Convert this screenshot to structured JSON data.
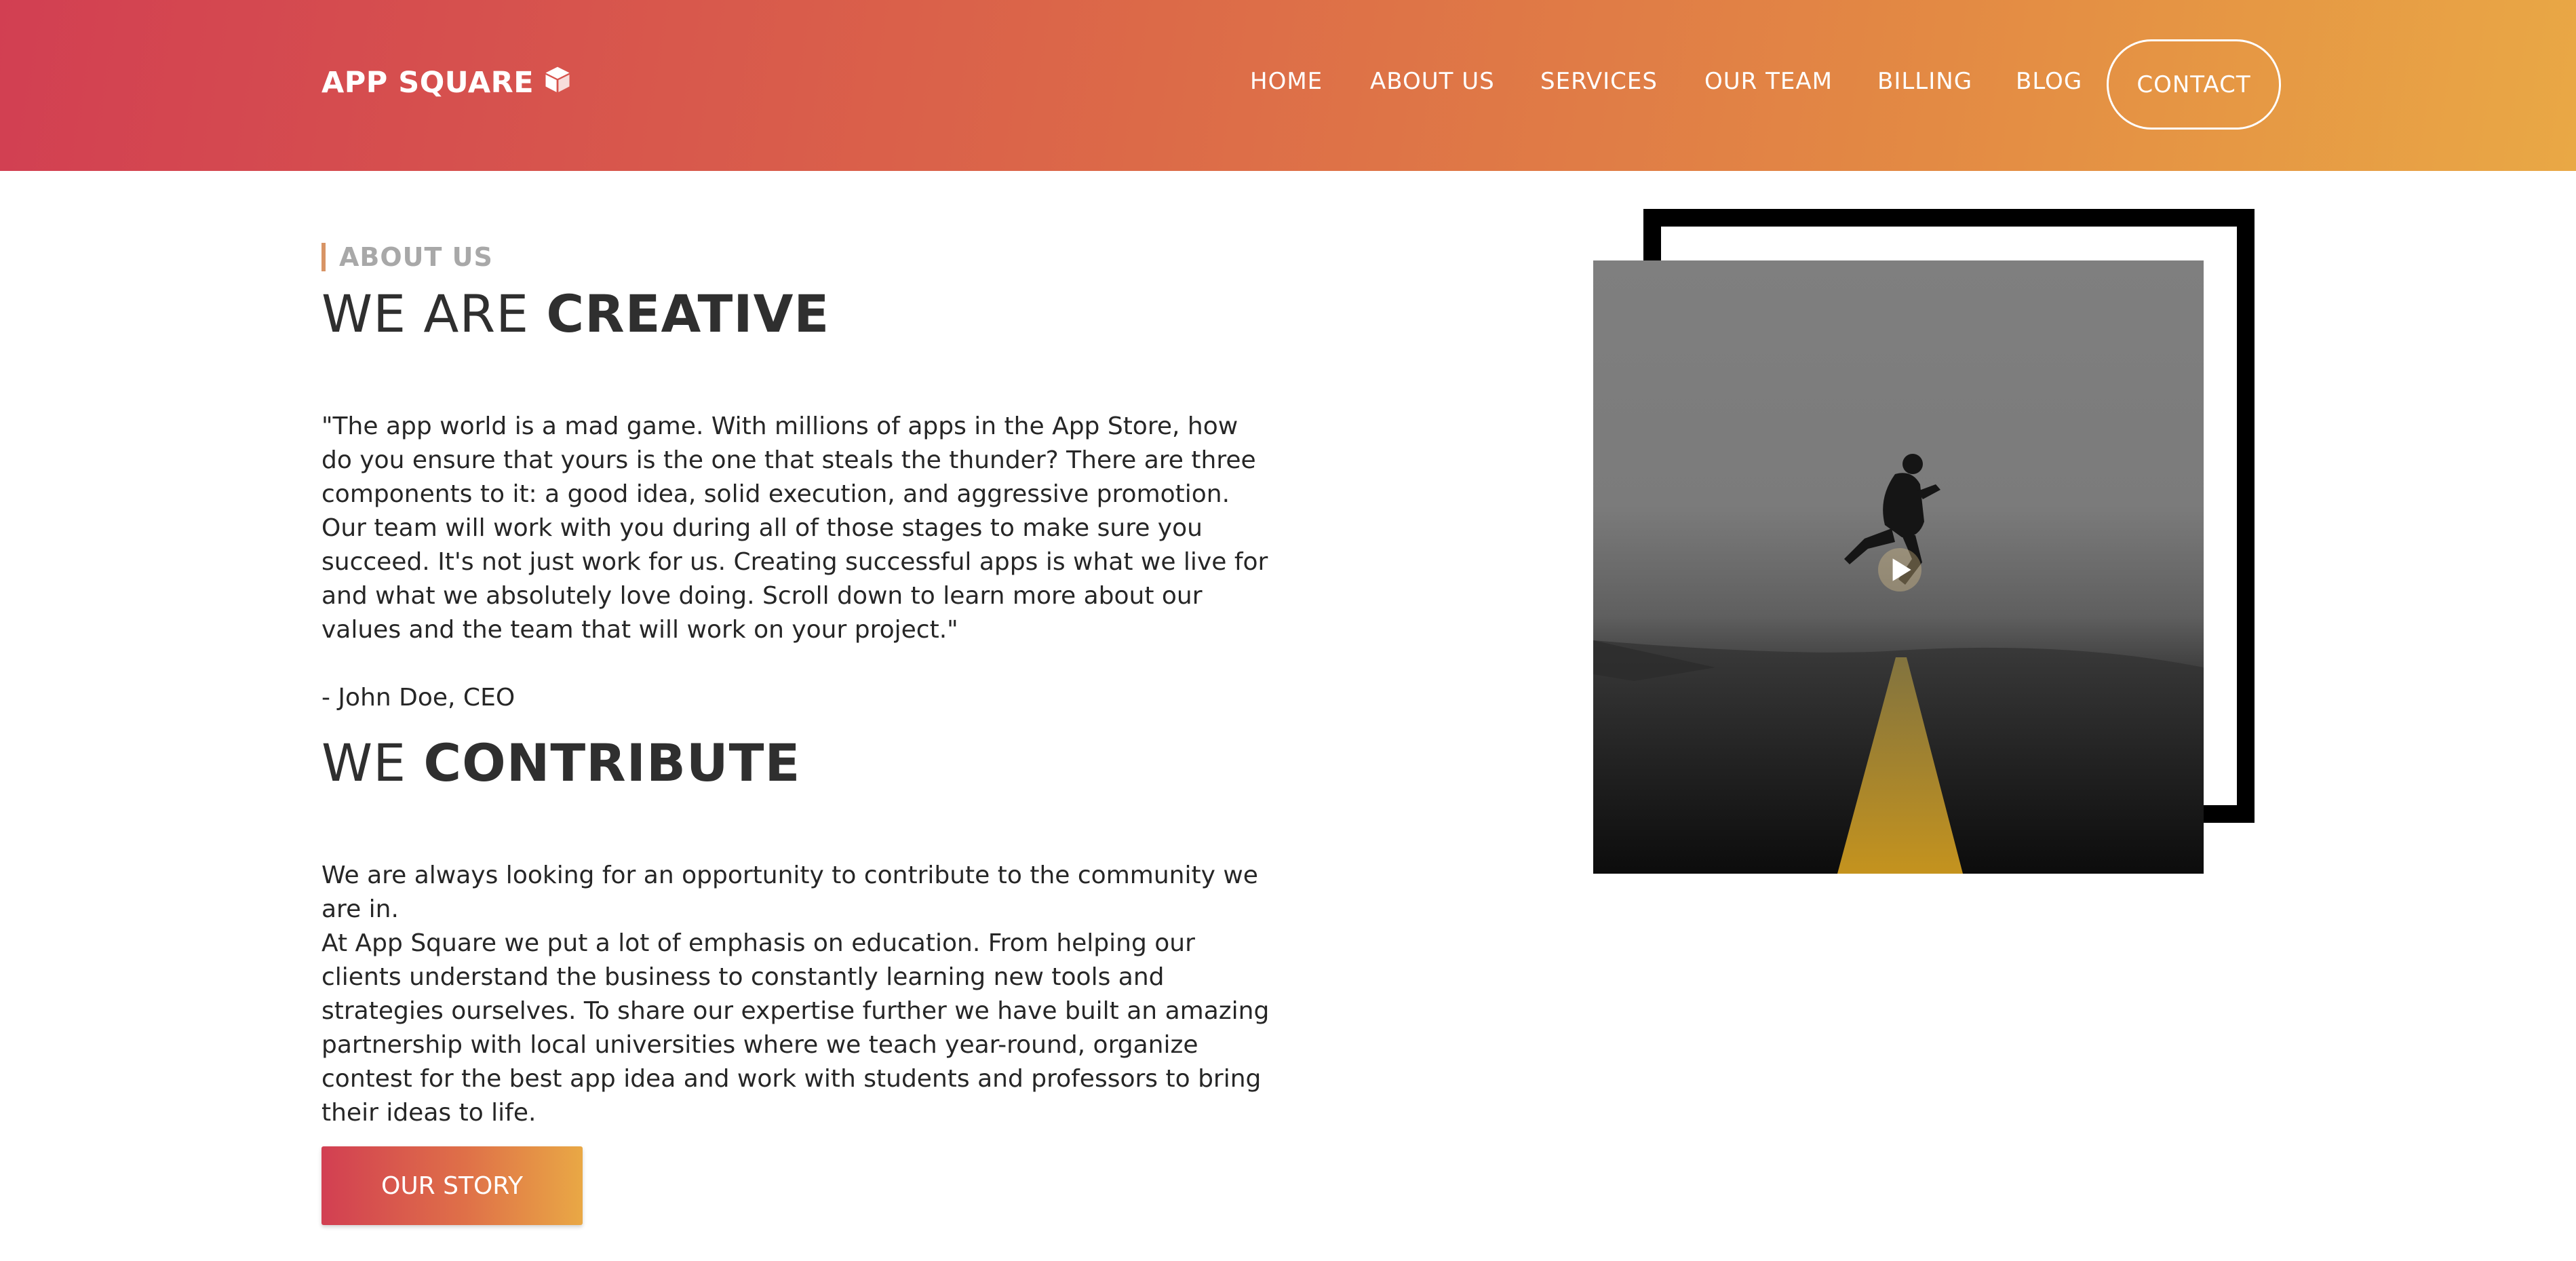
{
  "header": {
    "logo_text": "APP SQUARE",
    "logo_icon": "cube-icon",
    "nav": {
      "home": "HOME",
      "about": "ABOUT US",
      "services": "SERVICES",
      "team": "OUR TEAM",
      "billing": "BILLING",
      "blog": "BLOG",
      "contact": "CONTACT"
    }
  },
  "about": {
    "eyebrow": "ABOUT US",
    "heading1_light": "WE ARE ",
    "heading1_bold": "CREATIVE",
    "quote": "\"The app world is a mad game. With millions of apps in the App Store, how do you ensure that yours is the one that steals the thunder? There are three components to it: a good idea, solid execution, and aggressive promotion. Our team will work with you during all of those stages to make sure you succeed. It's not just work for us. Creating successful apps is what we live for and what we absolutely love doing. Scroll down to learn more about our values and the team that will work on your project.\"",
    "attribution": "- John Doe, CEO",
    "heading2_light": "WE ",
    "heading2_bold": "CONTRIBUTE",
    "contribute_line1": "We are always looking for an opportunity to contribute to the community we are in.",
    "contribute_line2": "At App Square we put a lot of emphasis on education. From helping our clients understand the business to constantly learning new tools and strategies ourselves. To share our expertise further we have built an amazing partnership with local universities where we teach year-round, organize contest for the best app idea and work with students and professors to bring their ideas to life.",
    "cta": "OUR STORY"
  },
  "media": {
    "play_icon": "play-icon",
    "image_subject": "man-jumping-on-road",
    "frame_color": "#000000"
  },
  "colors": {
    "gradient_start": "#d23f52",
    "gradient_end": "#e9a845",
    "eyebrow_bar": "#d89465"
  }
}
